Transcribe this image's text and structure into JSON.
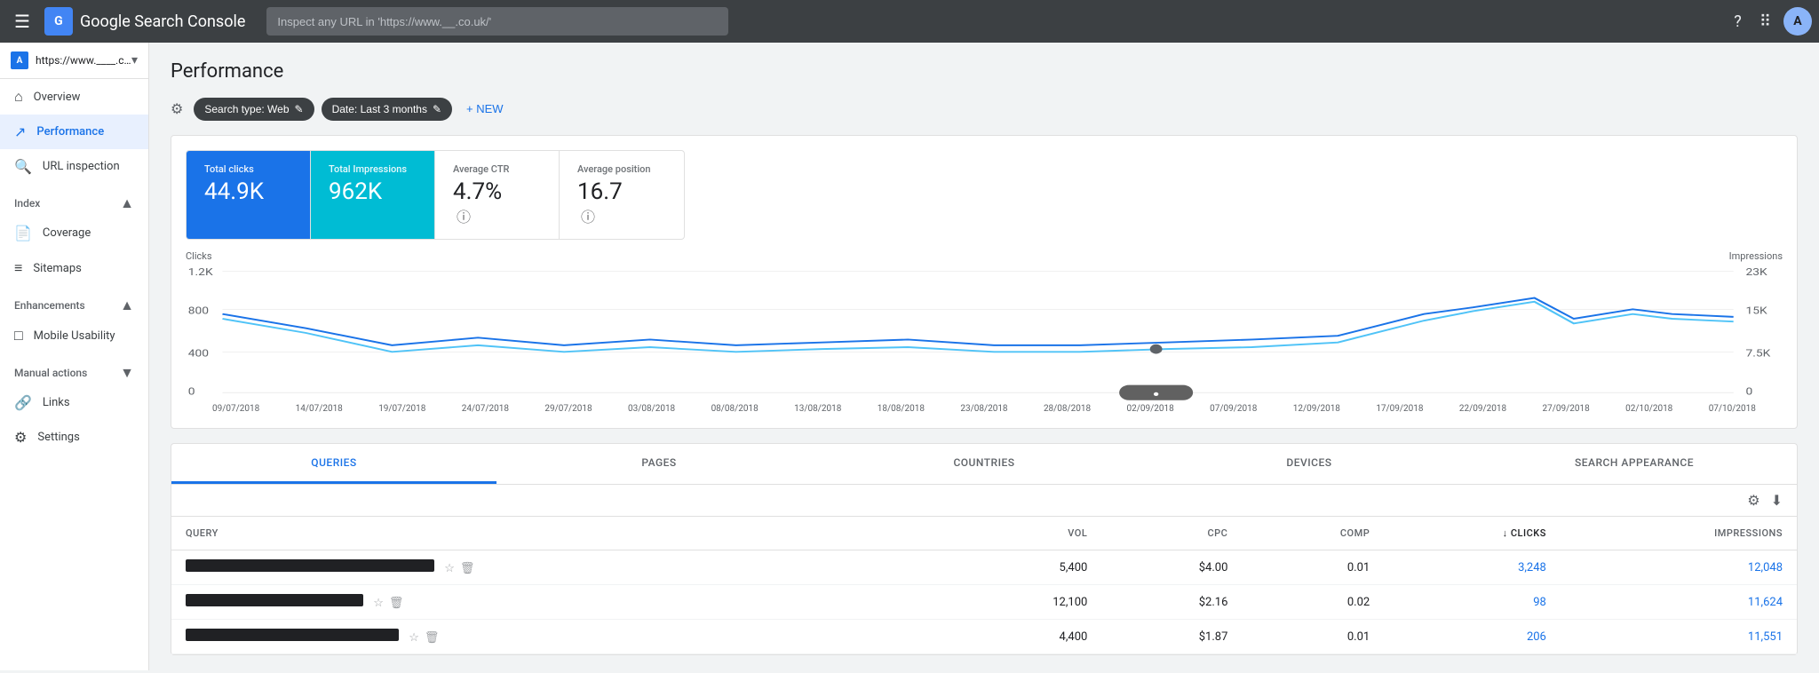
{
  "topNav": {
    "hamburger": "☰",
    "logoText": "Google Search Console",
    "logoInitial": "G",
    "searchPlaceholder": "Inspect any URL in 'https://www.__.co.uk/'",
    "helpIcon": "?",
    "appsIcon": "⋮⋮",
    "accountIcon": "A"
  },
  "sidebar": {
    "property": {
      "initial": "A",
      "url": "https://www.____.co.uk/",
      "arrow": "▾"
    },
    "mainItems": [
      {
        "id": "overview",
        "label": "Overview",
        "icon": "⌂"
      },
      {
        "id": "performance",
        "label": "Performance",
        "icon": "↗",
        "active": true
      },
      {
        "id": "url-inspection",
        "label": "URL inspection",
        "icon": "🔍"
      }
    ],
    "indexSection": {
      "label": "Index",
      "toggle": "▲"
    },
    "indexItems": [
      {
        "id": "coverage",
        "label": "Coverage",
        "icon": "📄"
      },
      {
        "id": "sitemaps",
        "label": "Sitemaps",
        "icon": "≡"
      }
    ],
    "enhancementsSection": {
      "label": "Enhancements",
      "toggle": "▲"
    },
    "enhancementsItems": [
      {
        "id": "mobile-usability",
        "label": "Mobile Usability",
        "icon": "□"
      }
    ],
    "manualActionsSection": {
      "label": "Manual actions",
      "toggle": "▼"
    },
    "bottomItems": [
      {
        "id": "links",
        "label": "Links",
        "icon": "🔗"
      },
      {
        "id": "settings",
        "label": "Settings",
        "icon": "⚙"
      }
    ]
  },
  "performance": {
    "title": "Performance",
    "filters": {
      "searchType": "Search type: Web",
      "date": "Date: Last 3 months",
      "newLabel": "+ NEW"
    },
    "metrics": [
      {
        "id": "total-clicks",
        "label": "Total clicks",
        "value": "44.9K",
        "active": "blue"
      },
      {
        "id": "total-impressions",
        "label": "Total Impressions",
        "value": "962K",
        "active": "cyan"
      },
      {
        "id": "avg-ctr",
        "label": "Average CTR",
        "value": "4.7%",
        "active": ""
      },
      {
        "id": "avg-position",
        "label": "Average position",
        "value": "16.7",
        "active": ""
      }
    ],
    "chart": {
      "yAxisLeft": [
        "1.2K",
        "800",
        "400",
        "0"
      ],
      "yAxisRight": [
        "23K",
        "15K",
        "7.5K",
        "0"
      ],
      "yLabelLeft": "Clicks",
      "yLabelRight": "Impressions",
      "xLabels": [
        "09/07/2018",
        "14/07/2018",
        "19/07/2018",
        "24/07/2018",
        "29/07/2018",
        "03/08/2018",
        "08/08/2018",
        "13/08/2018",
        "18/08/2018",
        "23/08/2018",
        "28/08/2018",
        "02/09/2018",
        "07/09/2018",
        "12/09/2018",
        "17/09/2018",
        "22/09/2018",
        "27/09/2018",
        "02/10/2018",
        "07/10/2018"
      ]
    },
    "tabs": [
      "QUERIES",
      "PAGES",
      "COUNTRIES",
      "DEVICES",
      "SEARCH APPEARANCE"
    ],
    "activeTab": "QUERIES",
    "table": {
      "columns": [
        {
          "id": "query",
          "label": "Query",
          "align": "left"
        },
        {
          "id": "vol",
          "label": "Vol",
          "align": "right"
        },
        {
          "id": "cpc",
          "label": "CPC",
          "align": "right"
        },
        {
          "id": "comp",
          "label": "Comp",
          "align": "right"
        },
        {
          "id": "clicks",
          "label": "Clicks",
          "align": "right",
          "sorted": true
        },
        {
          "id": "impressions",
          "label": "Impressions",
          "align": "right"
        }
      ],
      "rows": [
        {
          "query": "REDACTED_1",
          "queryWidth": 280,
          "vol": "5,400",
          "cpc": "$4.00",
          "comp": "0.01",
          "clicks": "3,248",
          "impressions": "12,048"
        },
        {
          "query": "REDACTED_2",
          "queryWidth": 200,
          "vol": "12,100",
          "cpc": "$2.16",
          "comp": "0.02",
          "clicks": "98",
          "impressions": "11,624"
        },
        {
          "query": "REDACTED_3",
          "queryWidth": 240,
          "vol": "4,400",
          "cpc": "$1.87",
          "comp": "0.01",
          "clicks": "206",
          "impressions": "11,551"
        }
      ]
    }
  },
  "colors": {
    "accent": "#1a73e8",
    "cyan": "#00bcd4",
    "clicksLine": "#1a73e8",
    "impressionsLine": "#4fc3f7"
  }
}
